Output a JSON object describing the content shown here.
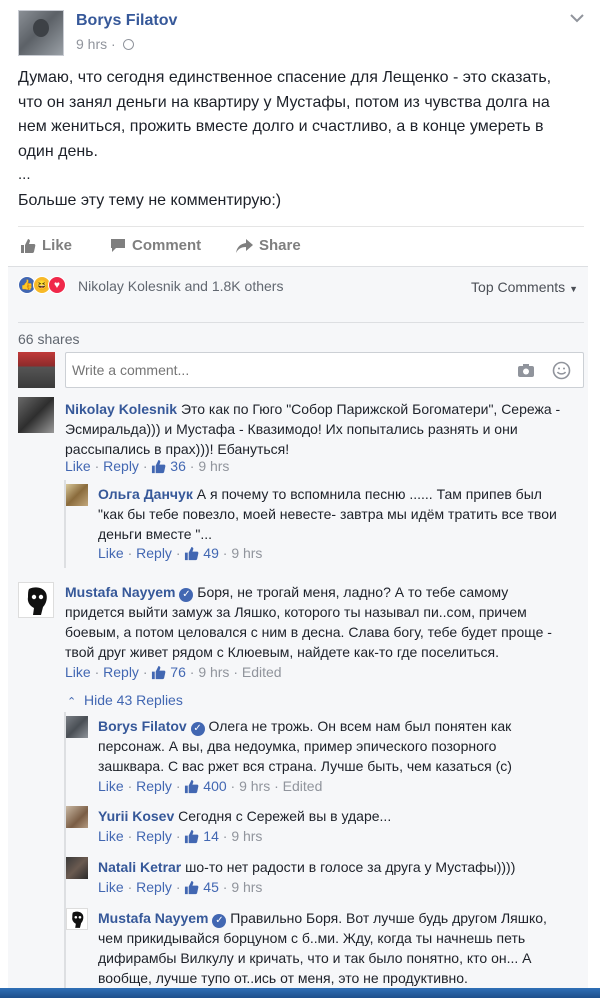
{
  "post": {
    "author": "Borys Filatov",
    "time": "9 hrs",
    "body_lines": [
      "Думаю, что сегодня единственное спасение для Лещенко - это сказать,",
      "что он занял деньги на квартиру у Мустафы, потом из чувства долга на",
      "нем жениться, прожить вместе долго и счастливо, а в конце умереть в",
      "один день."
    ],
    "ellipsis": "...",
    "last_line": "Больше эту тему не комментирую:)"
  },
  "actions": {
    "like": "Like",
    "comment": "Comment",
    "share": "Share"
  },
  "reactions": {
    "icons": [
      "like-reaction-icon",
      "haha-reaction-icon",
      "love-reaction-icon"
    ],
    "summary": "Nikolay Kolesnik and 1.8K others",
    "sort": "Top Comments"
  },
  "shares": "66 shares",
  "composer": {
    "placeholder": "Write a comment..."
  },
  "comments": [
    {
      "author": "Nikolay Kolesnik",
      "lines": [
        "Это как по Гюго \"Собор Парижской Богоматери\", Сережа -",
        "Эсмиральда))) и Мустафа - Квазимодо! Их попытались разнять и они",
        "рассыпались в прах)))! Ебануться!"
      ],
      "like": "Like",
      "reply": "Reply",
      "count": "36",
      "time": "9 hrs"
    },
    {
      "author": "Ольга Данчук",
      "lines": [
        "А я почему то вспомнила песню ...... Там припев был",
        "\"как бы тебе повезло, моей невесте- завтра мы идём тратить все твои",
        "деньги вместе \"..."
      ],
      "like": "Like",
      "reply": "Reply",
      "count": "49",
      "time": "9 hrs"
    },
    {
      "author": "Mustafa Nayyem",
      "lines": [
        "Боря, не трогай меня, ладно? А то тебе самому",
        "придется выйти замуж за Ляшко, которого ты называл пи..сом, причем",
        "боевым, а потом целовался с ним в десна. Слава богу, тебе будет проще -",
        "твой друг живет рядом с Клюевым, найдете как-то где поселиться."
      ],
      "like": "Like",
      "reply": "Reply",
      "count": "76",
      "time": "9 hrs",
      "edited": "Edited"
    },
    {
      "author": "Borys Filatov",
      "lines": [
        "Олега не трожь. Он всем нам был понятен как",
        "персонаж. А вы, два недоумка, пример эпического позорного",
        "зашквара. С вас ржет вся страна. Лучше быть, чем казаться (с)"
      ],
      "like": "Like",
      "reply": "Reply",
      "count": "400",
      "time": "9 hrs",
      "edited": "Edited"
    },
    {
      "author": "Yurii Kosev",
      "lines": [
        "Сегодня с Сережей вы в ударе..."
      ],
      "like": "Like",
      "reply": "Reply",
      "count": "14",
      "time": "9 hrs"
    },
    {
      "author": "Natali Ketrar",
      "lines": [
        "шо-то нет радости в голосе за друга у Мустафы))))"
      ],
      "like": "Like",
      "reply": "Reply",
      "count": "45",
      "time": "9 hrs"
    },
    {
      "author": "Mustafa Nayyem",
      "lines": [
        "Правильно Боря. Вот лучше будь другом Ляшко,",
        "чем прикидывайся борцуном с б..ми. Жду, когда ты начнешь петь",
        "дифирамбы Вилкулу и кричать, что и так было понятно, кто он... А",
        "вообще, лучше тупо от..ись от меня, это не продуктивно."
      ]
    }
  ],
  "hide_replies": "Hide 43 Replies",
  "colors": {
    "link": "#365899",
    "like_blue": "#4267b2",
    "muted": "#90949c",
    "bottom_bar": "#2f6fb6"
  }
}
